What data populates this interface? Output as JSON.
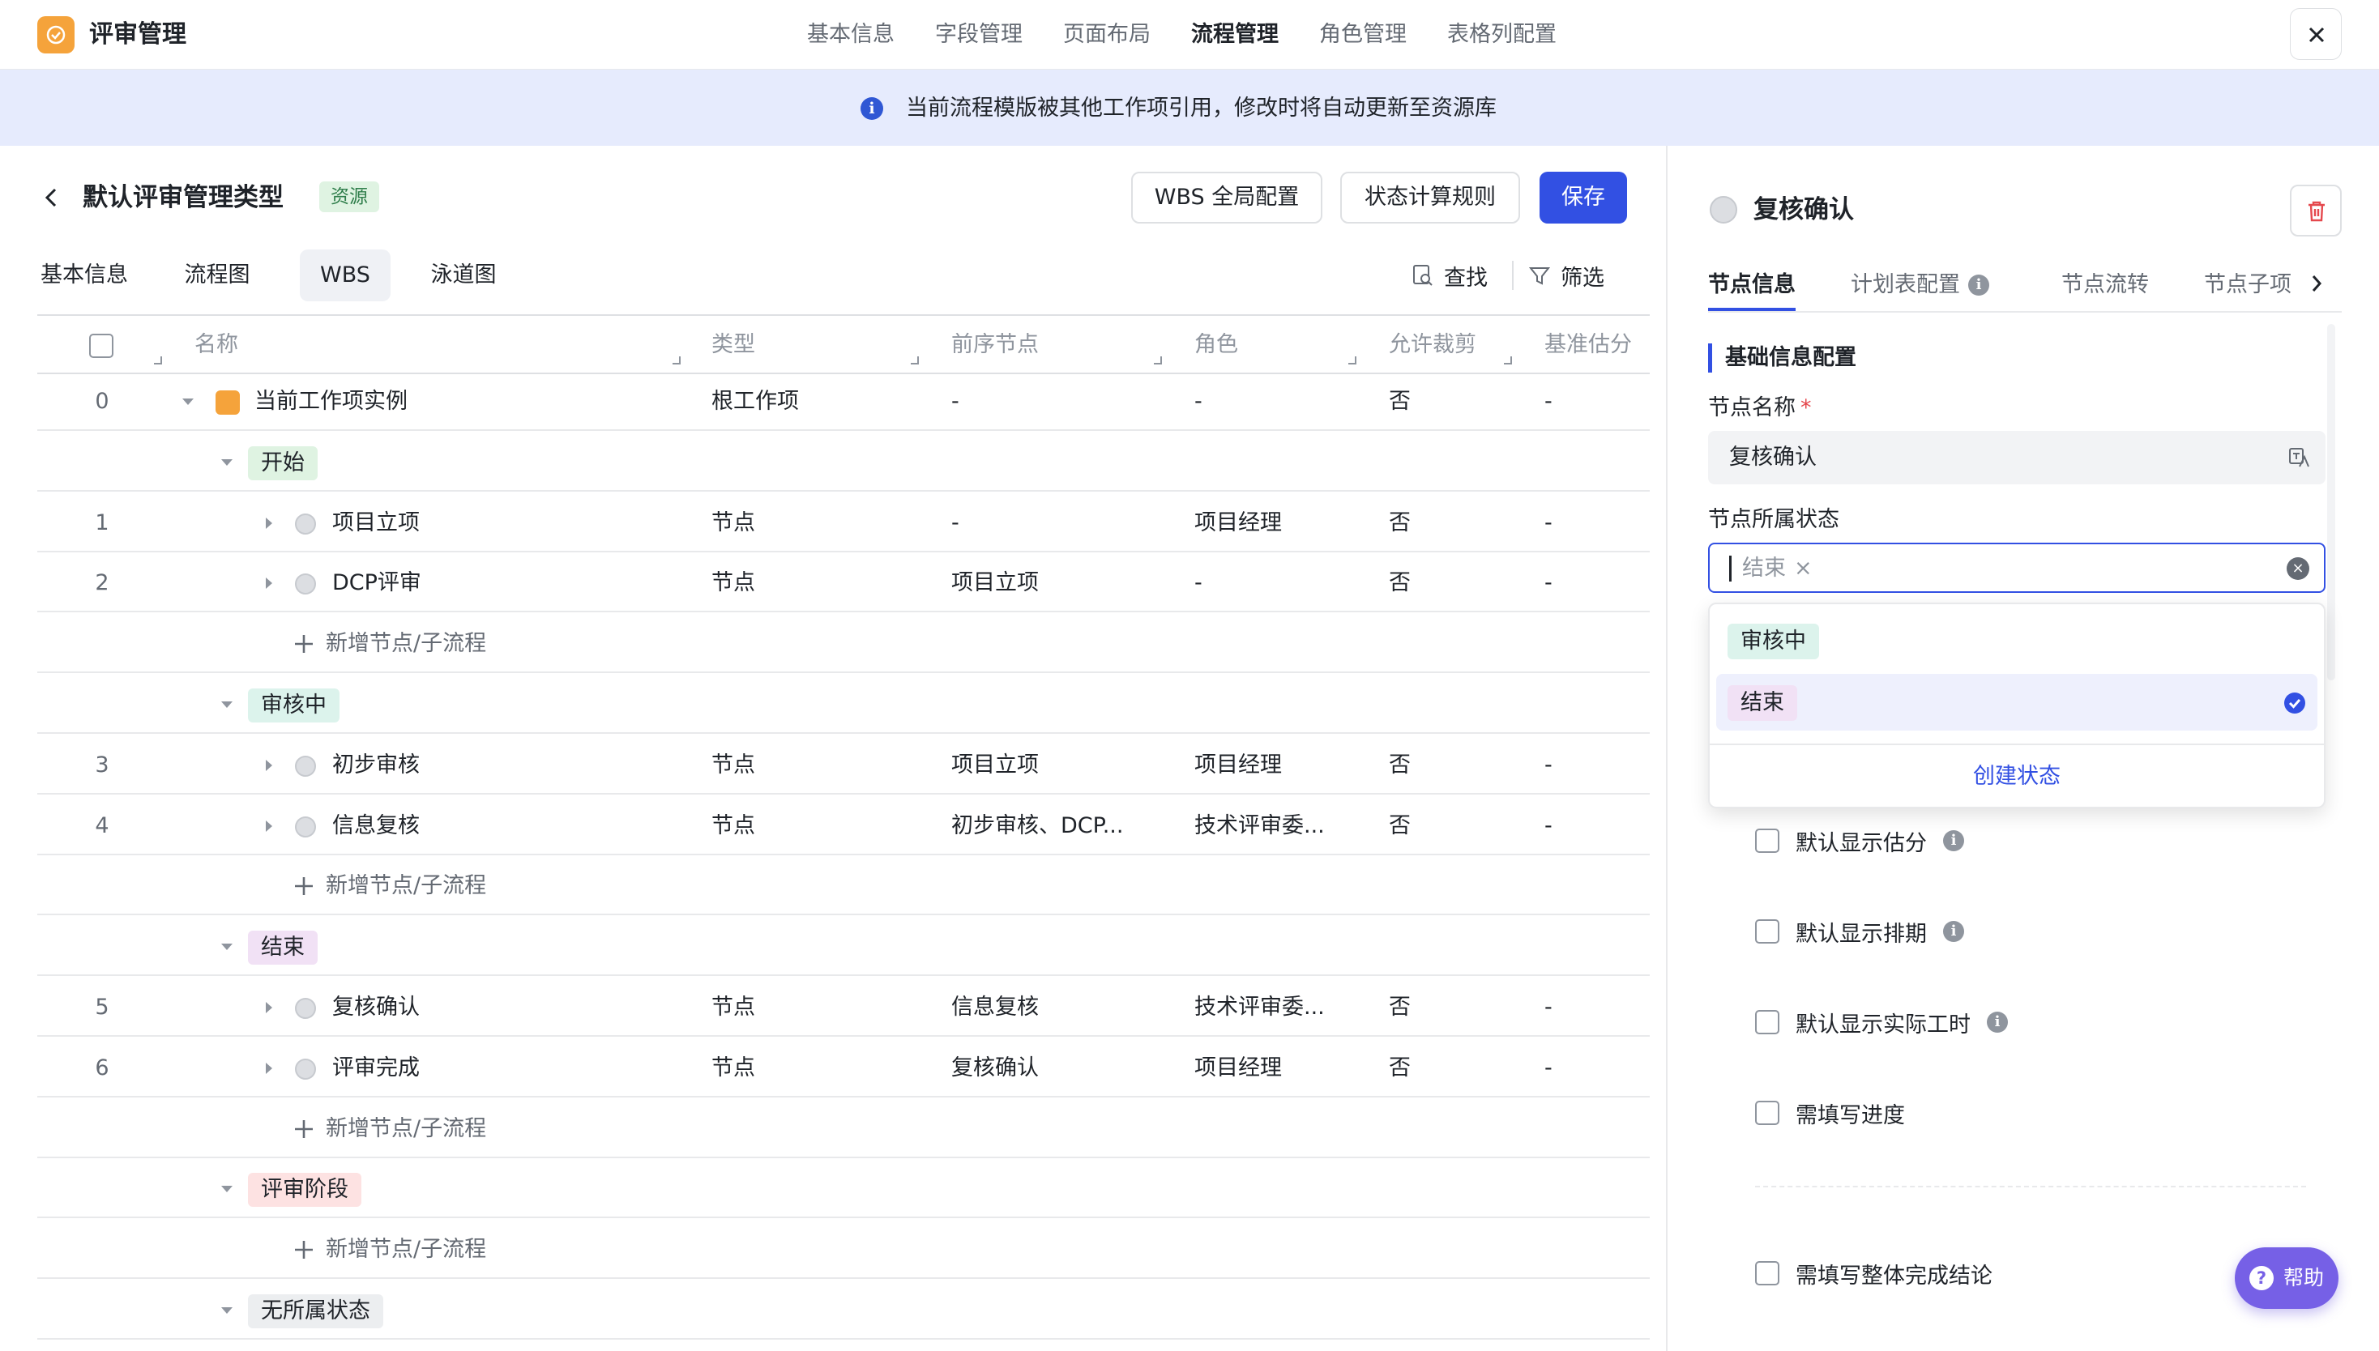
{
  "app": {
    "title": "评审管理"
  },
  "top_nav": [
    {
      "label": "基本信息",
      "active": false
    },
    {
      "label": "字段管理",
      "active": false
    },
    {
      "label": "页面布局",
      "active": false
    },
    {
      "label": "流程管理",
      "active": true
    },
    {
      "label": "角色管理",
      "active": false
    },
    {
      "label": "表格列配置",
      "active": false
    }
  ],
  "notice": {
    "text": "当前流程模版被其他工作项引用，修改时将自动更新至资源库"
  },
  "header": {
    "title": "默认评审管理类型",
    "tag": "资源",
    "wbs_button": "WBS 全局配置",
    "rule_button": "状态计算规则",
    "save_button": "保存"
  },
  "sub_tabs": [
    {
      "label": "基本信息",
      "active": false
    },
    {
      "label": "流程图",
      "active": false
    },
    {
      "label": "WBS",
      "active": true
    },
    {
      "label": "泳道图",
      "active": false
    }
  ],
  "toolbar": {
    "find": "查找",
    "filter": "筛选"
  },
  "table": {
    "columns": [
      "名称",
      "类型",
      "前序节点",
      "角色",
      "允许裁剪",
      "基准估分"
    ],
    "root": {
      "index": "0",
      "name": "当前工作项实例",
      "type": "根工作项",
      "prev": "-",
      "role": "-",
      "trim": "否",
      "estimate": "-"
    },
    "add_label": "新增节点/子流程",
    "groups": [
      {
        "status": "开始",
        "color": "#dff3e2",
        "rows": [
          {
            "index": "1",
            "name": "项目立项",
            "type": "节点",
            "prev": "-",
            "role": "项目经理",
            "trim": "否",
            "estimate": "-"
          },
          {
            "index": "2",
            "name": "DCP评审",
            "type": "节点",
            "prev": "项目立项",
            "role": "-",
            "trim": "否",
            "estimate": "-"
          }
        ]
      },
      {
        "status": "审核中",
        "color": "#dcf3ec",
        "rows": [
          {
            "index": "3",
            "name": "初步审核",
            "type": "节点",
            "prev": "项目立项",
            "role": "项目经理",
            "trim": "否",
            "estimate": "-"
          },
          {
            "index": "4",
            "name": "信息复核",
            "type": "节点",
            "prev": "初步审核、DCP...",
            "role": "技术评审委...",
            "trim": "否",
            "estimate": "-"
          }
        ]
      },
      {
        "status": "结束",
        "color": "#f1e1f5",
        "rows": [
          {
            "index": "5",
            "name": "复核确认",
            "type": "节点",
            "prev": "信息复核",
            "role": "技术评审委...",
            "trim": "否",
            "estimate": "-"
          },
          {
            "index": "6",
            "name": "评审完成",
            "type": "节点",
            "prev": "复核确认",
            "role": "项目经理",
            "trim": "否",
            "estimate": "-"
          }
        ]
      },
      {
        "status": "评审阶段",
        "color": "#fde2e2",
        "rows": []
      },
      {
        "status": "无所属状态",
        "color": "#eceef0",
        "rows": [],
        "no_add": true
      }
    ]
  },
  "panel": {
    "node_title": "复核确认",
    "tabs": [
      {
        "label": "节点信息",
        "active": true
      },
      {
        "label": "计划表配置",
        "active": false,
        "info": true
      },
      {
        "label": "节点流转",
        "active": false
      },
      {
        "label": "节点子项",
        "active": false
      }
    ],
    "section_title": "基础信息配置",
    "name_label": "节点名称",
    "required_mark": "*",
    "name_value": "复核确认",
    "status_label": "节点所属状态",
    "status_chip": "结束",
    "chip_remove": "×",
    "clear_glyph": "×",
    "dropdown": {
      "options": [
        {
          "label": "审核中",
          "color": "#dcf3ec",
          "selected": false
        },
        {
          "label": "结束",
          "color": "#f1e1f5",
          "selected": true
        }
      ],
      "create_label": "创建状态"
    },
    "checkboxes": [
      {
        "label": "默认显示估分",
        "info": true
      },
      {
        "label": "默认显示排期",
        "info": true
      },
      {
        "label": "默认显示实际工时",
        "info": true
      },
      {
        "label": "需填写进度",
        "info": false
      },
      {
        "label": "需填写整体完成结论",
        "info": false
      }
    ],
    "info_glyph": "i"
  },
  "help": {
    "label": "帮助",
    "glyph": "?"
  },
  "colors": {
    "accent": "#3250e3",
    "notice_bg": "#e6ebfd",
    "logo": "#f5a33b",
    "help": "#7660e6"
  }
}
